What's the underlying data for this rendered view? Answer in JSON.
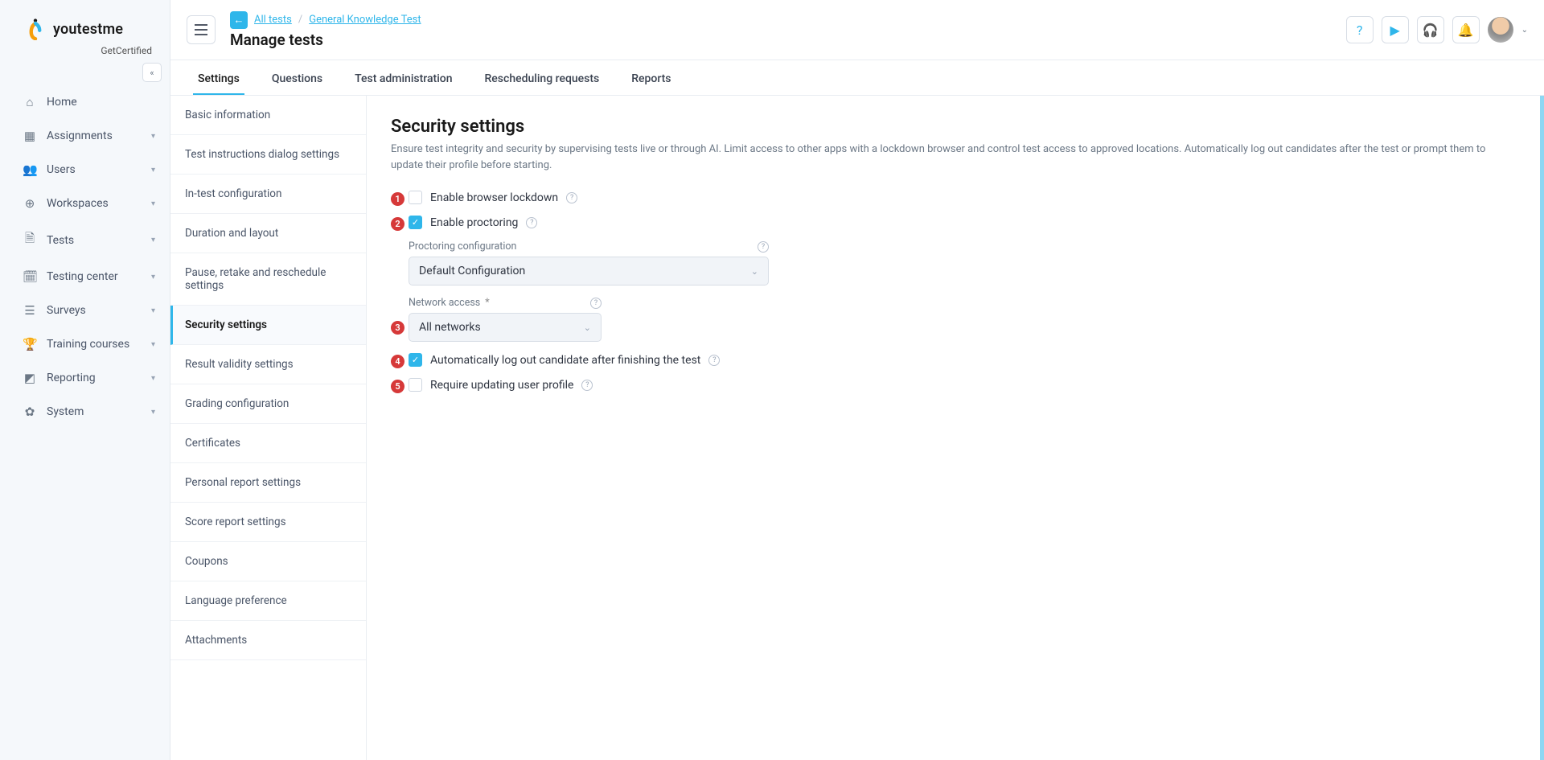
{
  "brand": {
    "text": "youtestme",
    "sub": "GetCertified"
  },
  "nav": [
    {
      "icon": "⌂",
      "label": "Home",
      "expandable": false
    },
    {
      "icon": "▦",
      "label": "Assignments",
      "expandable": true
    },
    {
      "icon": "👥",
      "label": "Users",
      "expandable": true
    },
    {
      "icon": "⊕",
      "label": "Workspaces",
      "expandable": true
    },
    {
      "icon": "🗎",
      "label": "Tests",
      "expandable": true
    },
    {
      "icon": "🗓",
      "label": "Testing center",
      "expandable": true
    },
    {
      "icon": "☰",
      "label": "Surveys",
      "expandable": true
    },
    {
      "icon": "🏆",
      "label": "Training courses",
      "expandable": true
    },
    {
      "icon": "◩",
      "label": "Reporting",
      "expandable": true
    },
    {
      "icon": "✿",
      "label": "System",
      "expandable": true
    }
  ],
  "breadcrumb": {
    "back": "←",
    "items": [
      "All tests",
      "General Knowledge Test"
    ]
  },
  "page_title": "Manage tests",
  "tabs": [
    "Settings",
    "Questions",
    "Test administration",
    "Rescheduling requests",
    "Reports"
  ],
  "active_tab": "Settings",
  "settings_nav": [
    "Basic information",
    "Test instructions dialog settings",
    "In-test configuration",
    "Duration and layout",
    "Pause, retake and reschedule settings",
    "Security settings",
    "Result validity settings",
    "Grading configuration",
    "Certificates",
    "Personal report settings",
    "Score report settings",
    "Coupons",
    "Language preference",
    "Attachments"
  ],
  "active_setting": "Security settings",
  "section": {
    "title": "Security settings",
    "desc": "Ensure test integrity and security by supervising tests live or through AI. Limit access to other apps with a lockdown browser and control test access to approved locations. Automatically log out candidates after the test or prompt them to update their profile before starting."
  },
  "options": {
    "opt1": {
      "num": "1",
      "label": "Enable browser lockdown",
      "checked": false
    },
    "opt2": {
      "num": "2",
      "label": "Enable proctoring",
      "checked": true
    },
    "proctoring_config_label": "Proctoring configuration",
    "proctoring_config_value": "Default Configuration",
    "network_label": "Network access",
    "network_value": "All networks",
    "opt3": {
      "num": "3"
    },
    "opt4": {
      "num": "4",
      "label": "Automatically log out candidate after finishing the test",
      "checked": true
    },
    "opt5": {
      "num": "5",
      "label": "Require updating user profile",
      "checked": false
    }
  }
}
